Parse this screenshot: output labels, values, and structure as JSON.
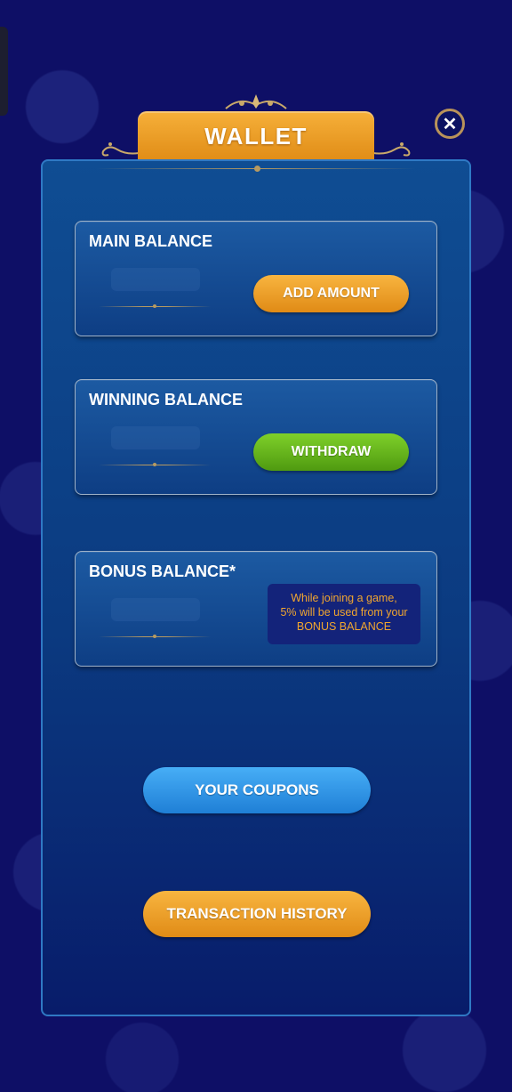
{
  "header": {
    "title": "WALLET",
    "close_icon": "close-icon"
  },
  "cards": {
    "main": {
      "title": "MAIN BALANCE",
      "button_label": "ADD AMOUNT"
    },
    "winning": {
      "title": "WINNING BALANCE",
      "button_label": "WITHDRAW"
    },
    "bonus": {
      "title": "BONUS BALANCE*",
      "note_lines": [
        "While joining a game,",
        "5% will be used from your",
        "BONUS BALANCE"
      ]
    }
  },
  "actions": {
    "coupons_label": "YOUR COUPONS",
    "history_label": "TRANSACTION HISTORY"
  },
  "colors": {
    "background": "#0e0f66",
    "panel": "#0f4d93",
    "accent_orange": "#f6a92c",
    "accent_green": "#6bbf1f",
    "accent_blue": "#3aa0ef",
    "note_text": "#f1a62f"
  }
}
